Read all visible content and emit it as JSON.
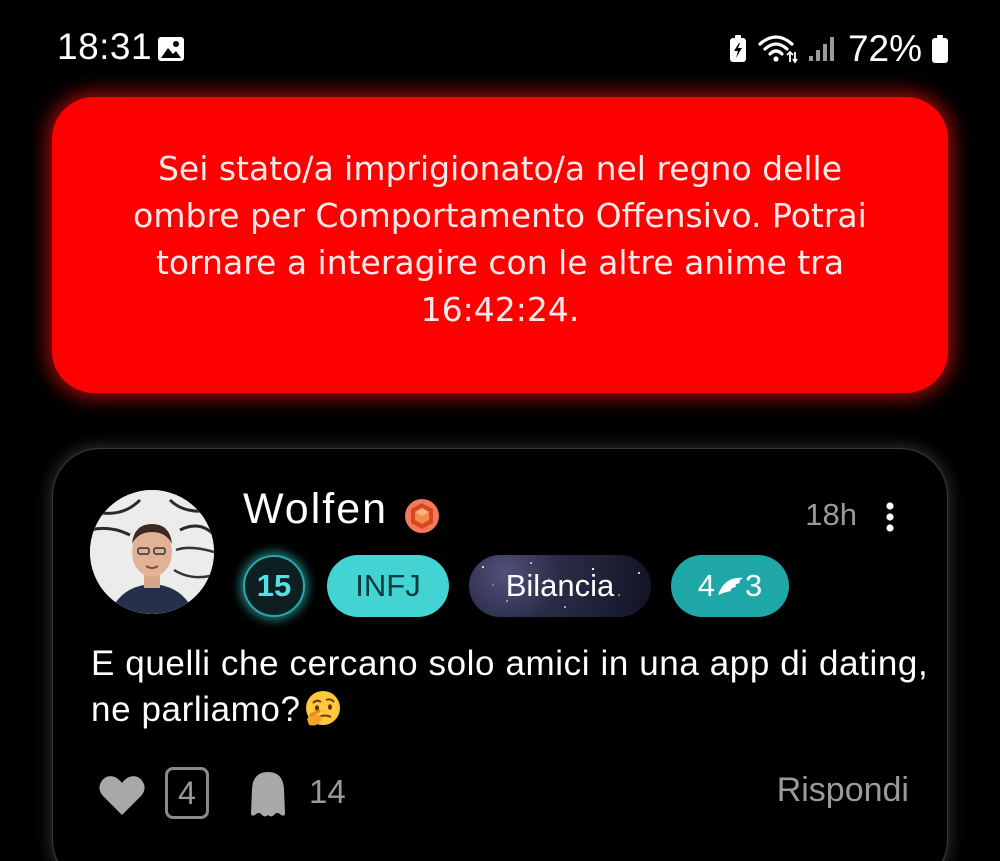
{
  "status_bar": {
    "time": "18:31",
    "battery_percent": "72%",
    "icons": [
      "image-icon",
      "battery-saver-icon",
      "wifi-icon",
      "signal-icon",
      "battery-icon"
    ]
  },
  "ban_banner": {
    "message": "Sei stato/a imprigionato/a nel regno delle ombre per Comportamento Offensivo. Potrai tornare a interagire con le altre anime tra 16:42:24.",
    "background_color": "#ff0000"
  },
  "post": {
    "username": "Wolfen",
    "time_ago": "18h",
    "level": "15",
    "mbti": "INFJ",
    "zodiac": "Bilancia",
    "wings_left": "4",
    "wings_right": "3",
    "body": "E quelli che cercano solo amici in una app di dating, ne parliamo?",
    "like_count": "4",
    "ghost_count": "14",
    "reply_label": "Rispondi",
    "accent_color": "#43d3d3"
  }
}
